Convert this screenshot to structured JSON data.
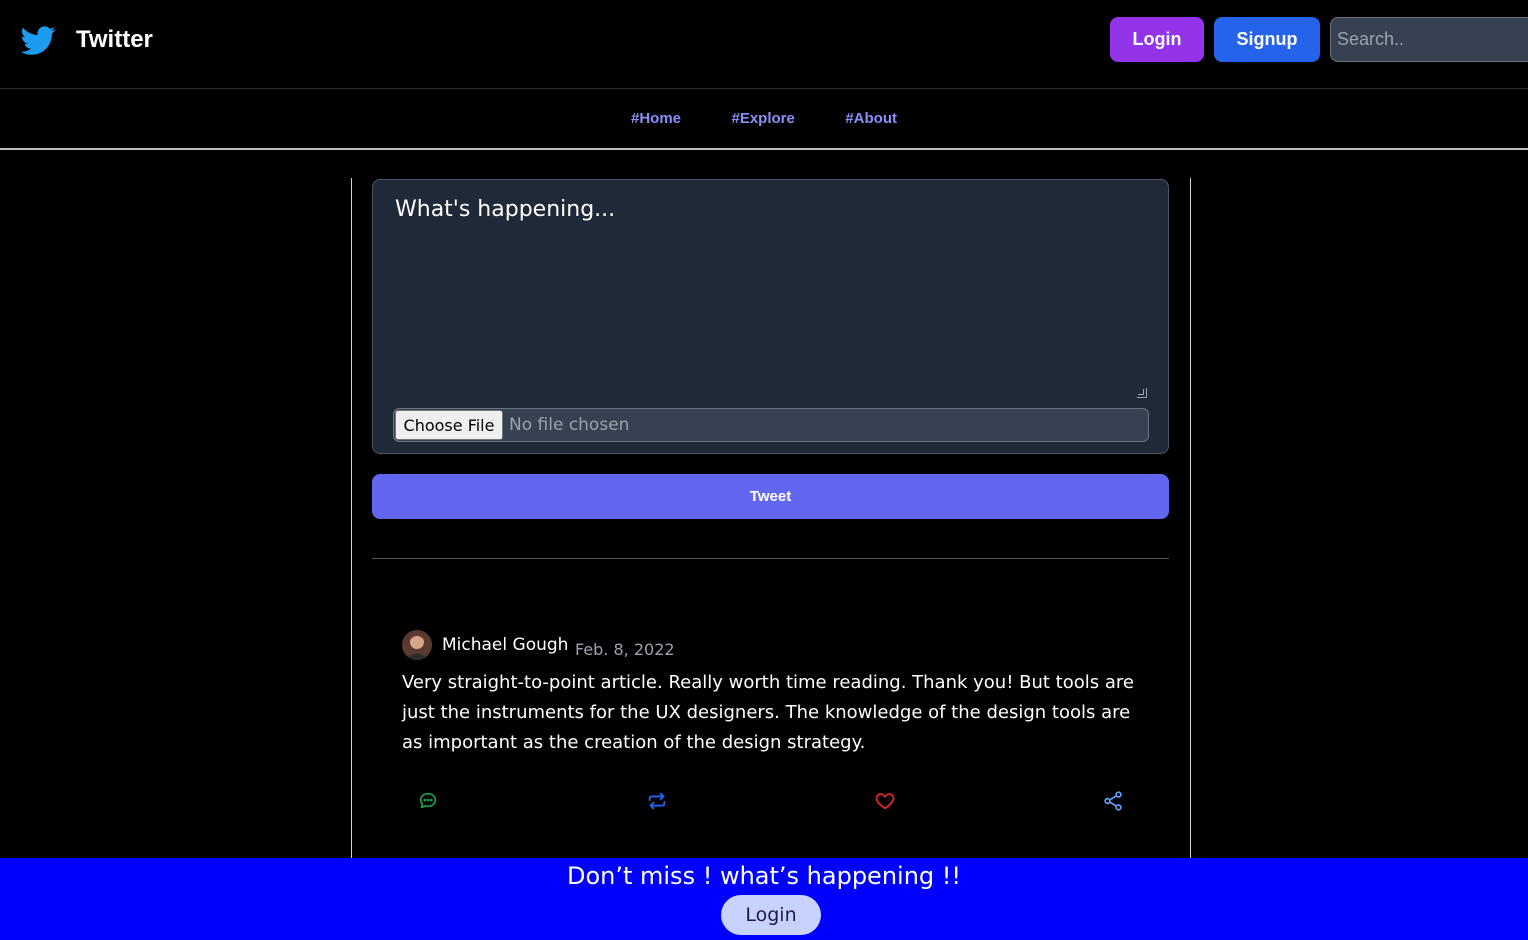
{
  "header": {
    "app_name": "Twitter",
    "logo_icon": "twitter-bird-icon",
    "login_label": "Login",
    "signup_label": "Signup",
    "search_placeholder": "Search..",
    "brand_color": "#1d9bf0",
    "login_color": "#9333ea",
    "signup_color": "#2563eb"
  },
  "nav": {
    "items": [
      {
        "label": "#Home"
      },
      {
        "label": "#Explore"
      },
      {
        "label": "#About"
      }
    ]
  },
  "composer": {
    "placeholder": "What's happening...",
    "file_button_label": "Choose File",
    "file_status": "No file chosen",
    "tweet_button_label": "Tweet",
    "tweet_button_color": "#6366f1"
  },
  "post": {
    "author": "Michael Gough",
    "date": "Feb. 8, 2022",
    "body": "Very straight-to-point article. Really worth time reading. Thank you! But tools are just the instruments for the UX designers. The knowledge of the design tools are as important as the creation of the design strategy.",
    "actions": [
      {
        "icon": "comment-icon",
        "color": "#16a34a"
      },
      {
        "icon": "retweet-icon",
        "color": "#2563eb"
      },
      {
        "icon": "heart-icon",
        "color": "#dc2626"
      },
      {
        "icon": "share-icon",
        "color": "#60a5fa"
      }
    ]
  },
  "banner": {
    "text": "Don’t miss ! what’s happening !!",
    "login_label": "Login",
    "background": "#0000ff"
  }
}
